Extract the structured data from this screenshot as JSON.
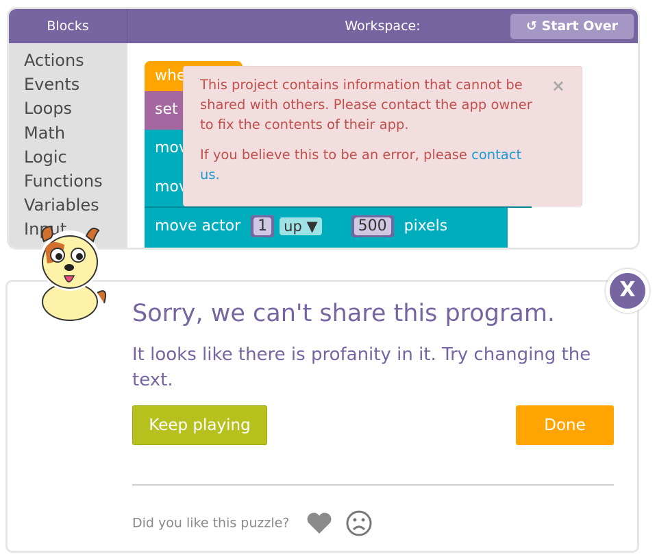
{
  "header": {
    "blocks_label": "Blocks",
    "workspace_label": "Workspace:",
    "start_over_label": "Start Over",
    "start_over_icon": "reset-icon"
  },
  "sidebar": {
    "items": [
      "Actions",
      "Events",
      "Loops",
      "Math",
      "Logic",
      "Functions",
      "Variables",
      "Input"
    ]
  },
  "blocks": {
    "when": "whe",
    "set": "set",
    "move1": "mov",
    "move2": "mov",
    "move_actor": "move actor",
    "actor_num": "1",
    "direction": "up",
    "distance": "500",
    "unit": "pixels"
  },
  "error": {
    "line1": "This project contains information that cannot be shared with others. Please contact the app owner to fix the contents of their app.",
    "line2": "If you believe this to be an error, please ",
    "link": "contact us.",
    "close": "×"
  },
  "dialog": {
    "title": "Sorry, we can't share this program.",
    "message": "It looks like there is profanity in it. Try changing the text.",
    "keep_playing": "Keep playing",
    "done": "Done",
    "feedback": "Did you like this puzzle?",
    "close": "X"
  },
  "colors": {
    "purple": "#7665a0",
    "teal": "#00adbc",
    "orange": "#ffa400",
    "green": "#b7c11d",
    "error_bg": "#f2dede",
    "error_text": "#c14f4c"
  }
}
